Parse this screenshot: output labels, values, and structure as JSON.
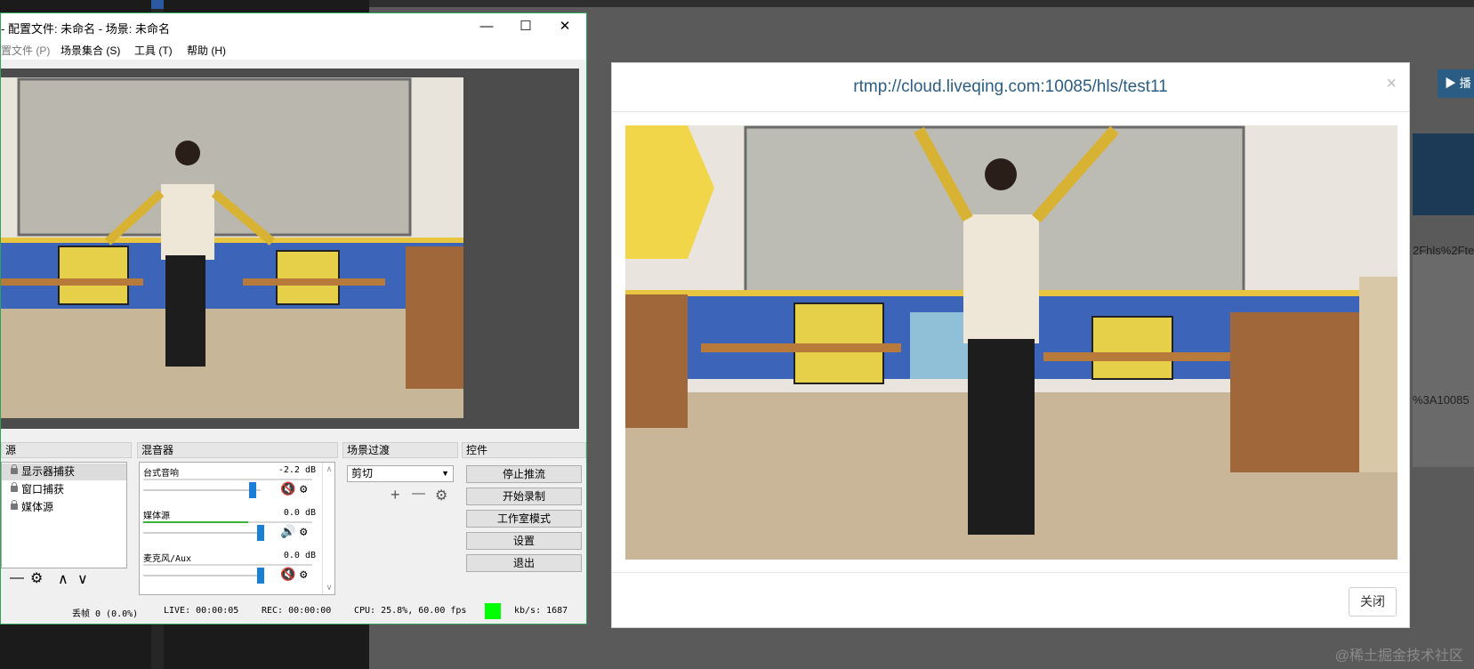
{
  "obs": {
    "title": "- 配置文件: 未命名 - 场景: 未命名",
    "window_controls": {
      "minimize": "—",
      "maximize": "☐",
      "close": "✕"
    },
    "menu": [
      "置文件 (P)",
      "场景集合 (S)",
      "工具 (T)",
      "帮助 (H)"
    ],
    "panels": {
      "sources": "源",
      "mixer": "混音器",
      "transitions": "场景过渡",
      "controls": "控件"
    },
    "sources": [
      {
        "label": "显示器捕获",
        "selected": true
      },
      {
        "label": "窗口捕获",
        "selected": false
      },
      {
        "label": "媒体源",
        "selected": false
      }
    ],
    "source_toolbar": {
      "remove": "—",
      "settings": "⚙",
      "up": "∧",
      "down": "∨"
    },
    "mixer": [
      {
        "name": "台式音响",
        "db": "-2.2 dB",
        "level": 0.0,
        "volume": 0.93,
        "muted": true
      },
      {
        "name": "媒体源",
        "db": "0.0 dB",
        "level": 0.62,
        "volume": 1.0,
        "muted": false
      },
      {
        "name": "麦克风/Aux",
        "db": "0.0 dB",
        "level": 0.0,
        "volume": 1.0,
        "muted": true
      }
    ],
    "transition": {
      "selected": "剪切",
      "add": "+",
      "remove": "—",
      "settings": "⚙"
    },
    "controls": [
      "停止推流",
      "开始录制",
      "工作室模式",
      "设置",
      "退出"
    ],
    "status": {
      "dropped": "丢帧 0 (0.0%)",
      "live": "LIVE: 00:00:05",
      "rec": "REC: 00:00:00",
      "cpu": "CPU: 25.8%, 60.00 fps",
      "bitrate": "kb/s: 1687",
      "indicator_color": "#00ff00"
    }
  },
  "modal": {
    "title": "rtmp://cloud.liveqing.com:10085/hls/test11",
    "close_x": "×",
    "close_button": "关闭"
  },
  "background": {
    "button_peek": "▶ 播",
    "text_peek_1": "2Fhls%2Fte",
    "text_peek_2": "%3A10085"
  },
  "watermark": "@稀土掘金技术社区",
  "colors": {
    "accent": "#2b5d84",
    "obs_border": "#2fa35a",
    "meter": "#3bb33b",
    "slider": "#1c7fd6"
  }
}
